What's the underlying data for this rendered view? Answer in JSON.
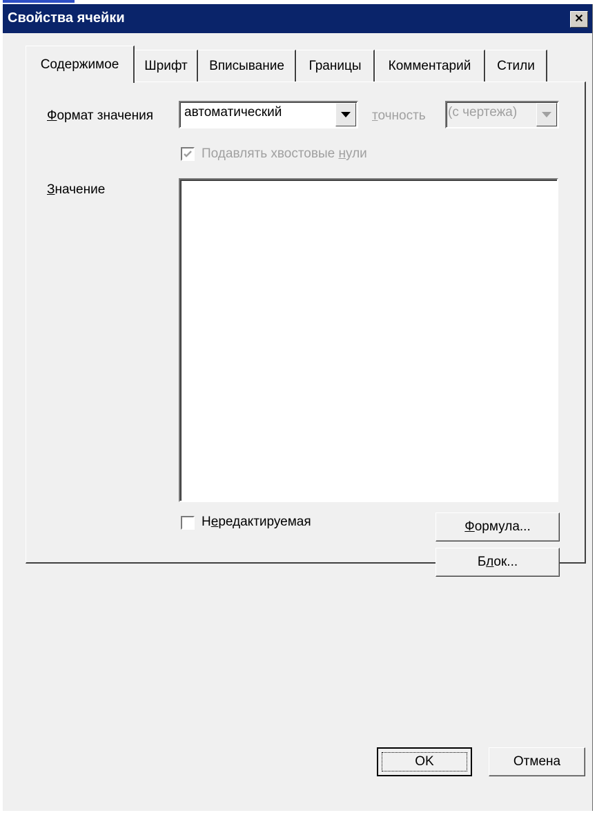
{
  "window": {
    "title": "Свойства ячейки",
    "close_glyph": "✕"
  },
  "tabs": [
    {
      "label": "Содержимое",
      "active": true
    },
    {
      "label": "Шрифт"
    },
    {
      "label": "Вписывание"
    },
    {
      "label": "Границы"
    },
    {
      "label": "Комментарий"
    },
    {
      "label": "Стили"
    }
  ],
  "format": {
    "label_mnemonic": "Ф",
    "label_rest": "ормат значения",
    "selected": "автоматический",
    "precision_mnemonic": "т",
    "precision_rest": "очность",
    "precision_selected": "(с чертежа)"
  },
  "suppress_zeros": {
    "label_before": "Подавлять хвостовые ",
    "label_mnemonic": "н",
    "label_after": "ули",
    "checked": true,
    "enabled": false
  },
  "value": {
    "label_mnemonic": "З",
    "label_rest": "начение",
    "text": ""
  },
  "readonly": {
    "label_before": "Н",
    "label_mnemonic": "е",
    "label_after": "редактируемая",
    "checked": false
  },
  "buttons": {
    "formula_mnemonic": "Ф",
    "formula_rest": "ормула...",
    "block_before": "Б",
    "block_mnemonic": "л",
    "block_after": "ок...",
    "ok": "OK",
    "cancel": "Отмена"
  },
  "colors": {
    "titlebar": "#0a246a",
    "dialog_bg": "#f0f0f0",
    "disabled_text": "#a0a0a0"
  }
}
